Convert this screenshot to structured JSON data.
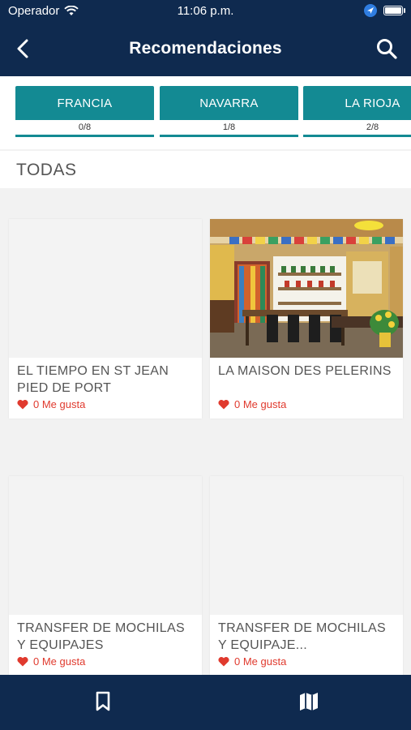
{
  "status_bar": {
    "carrier": "Operador",
    "time": "11:06 p.m."
  },
  "header": {
    "title": "Recomendaciones"
  },
  "tabs": [
    {
      "label": "FRANCIA",
      "count": "0/8"
    },
    {
      "label": "NAVARRA",
      "count": "1/8"
    },
    {
      "label": "LA RIOJA",
      "count": "2/8"
    }
  ],
  "section": {
    "title": "TODAS"
  },
  "cards": [
    {
      "title": "EL TIEMPO EN ST JEAN PIED DE PORT",
      "likes": "0 Me gusta"
    },
    {
      "title": "LA MAISON DES PELERINS",
      "likes": "0 Me gusta"
    },
    {
      "title": "TRANSFER DE MOCHILAS Y EQUIPAJES",
      "likes": "0 Me gusta"
    },
    {
      "title": "TRANSFER DE MOCHILAS Y EQUIPAJE...",
      "likes": "0 Me gusta"
    }
  ],
  "colors": {
    "navy": "#0f2a4f",
    "teal": "#138a93",
    "like_red": "#e03a2e"
  },
  "icons": {
    "back": "chevron-left-icon",
    "search": "search-icon",
    "bookmark": "bookmark-icon",
    "map": "map-icon"
  }
}
